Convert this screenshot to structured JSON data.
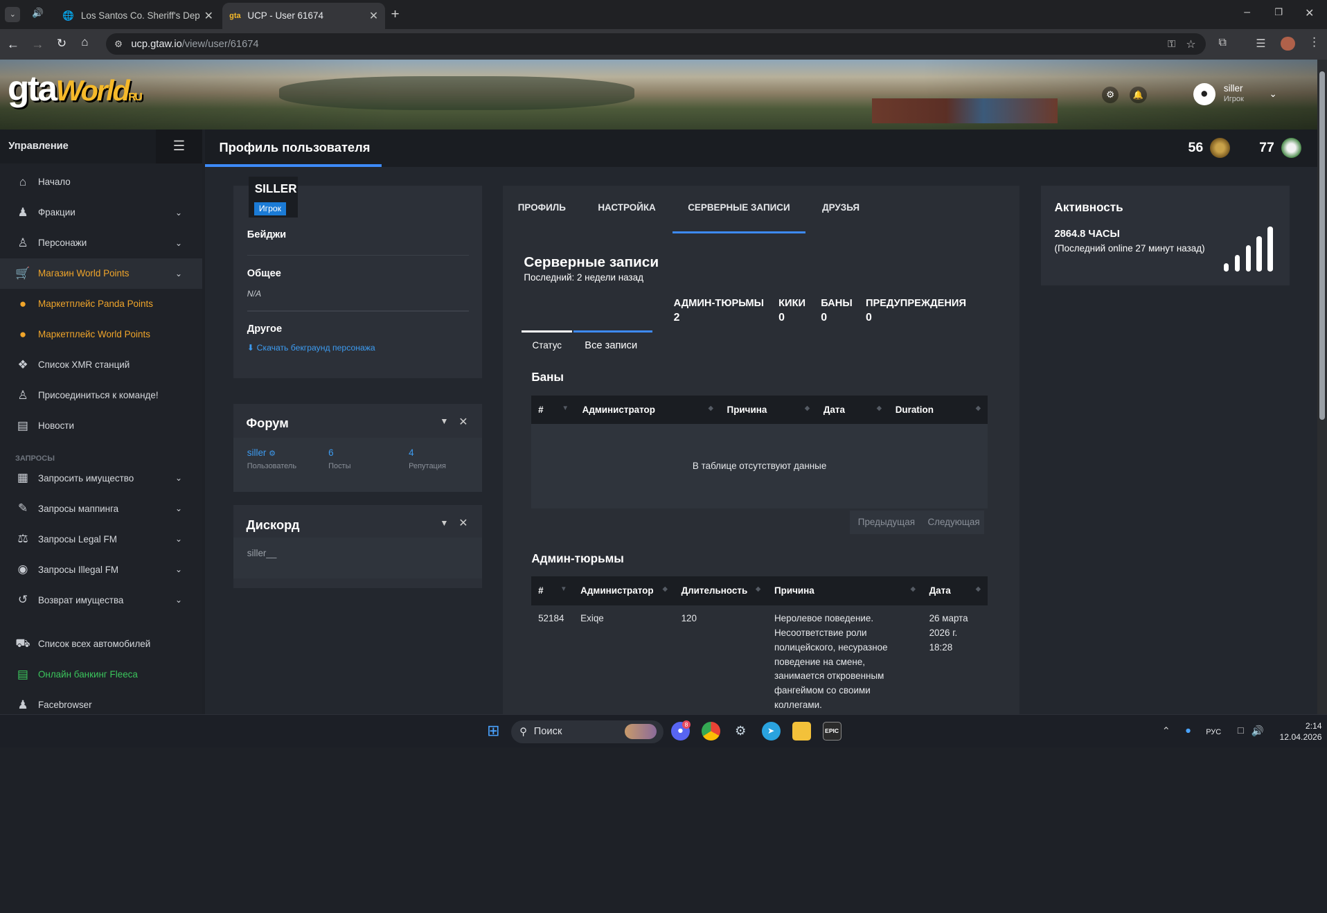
{
  "browser": {
    "tabs": [
      {
        "title": "Los Santos Co. Sheriff's Depart"
      },
      {
        "title": "UCP - User 61674"
      }
    ],
    "url_host": "ucp.gtaw.io",
    "url_path": "/view/user/61674"
  },
  "brand": {
    "logo_text": "gta",
    "logo_script": "World",
    "logo_suffix": "RU"
  },
  "topbar": {
    "user_name": "siller",
    "user_role": "Игрок"
  },
  "sidebar": {
    "header": "Управление",
    "items": [
      {
        "label": "Начало",
        "icon": "home-icon"
      },
      {
        "label": "Фракции",
        "icon": "users-icon"
      },
      {
        "label": "Персонажи",
        "icon": "user-icon"
      },
      {
        "label": "Магазин World Points",
        "icon": "cart-icon"
      },
      {
        "label": "Маркетплейс Panda Points",
        "icon": "coins-icon"
      },
      {
        "label": "Маркетплейс World Points",
        "icon": "coins-icon"
      },
      {
        "label": "Список XMR станций",
        "icon": "broadcast-icon"
      },
      {
        "label": "Присоединиться к команде!",
        "icon": "user-plus-icon"
      },
      {
        "label": "Новости",
        "icon": "newspaper-icon"
      }
    ],
    "section_requests": "ЗАПРОСЫ",
    "requests": [
      {
        "label": "Запросить имущество",
        "icon": "building-icon"
      },
      {
        "label": "Запросы маппинга",
        "icon": "paint-icon"
      },
      {
        "label": "Запросы Legal FM",
        "icon": "scale-icon"
      },
      {
        "label": "Запросы Illegal FM",
        "icon": "mask-icon"
      },
      {
        "label": "Возврат имущества",
        "icon": "undo-icon"
      }
    ],
    "bottom": [
      {
        "label": "Список всех автомобилей",
        "icon": "car-icon"
      },
      {
        "label": "Онлайн банкинг Fleeca",
        "icon": "bank-icon"
      },
      {
        "label": "Facebrowser",
        "icon": "users-icon"
      }
    ]
  },
  "header": {
    "title": "Профиль пользователя",
    "stat1": "56",
    "stat2": "77"
  },
  "profile": {
    "name": "SILLER",
    "role_badge": "Игрок",
    "badges_label": "Бейджи",
    "general_label": "Общее",
    "general_value": "N/A",
    "other_label": "Другое",
    "download_link": "Скачать бекграунд персонажа"
  },
  "forum": {
    "title": "Форум",
    "user": "siller",
    "user_label": "Пользователь",
    "posts": "6",
    "posts_label": "Посты",
    "rep": "4",
    "rep_label": "Репутация"
  },
  "discord": {
    "title": "Дискорд",
    "value": "siller__"
  },
  "tabs": {
    "profile": "ПРОФИЛЬ",
    "settings": "НАСТРОЙКА",
    "records": "СЕРВЕРНЫЕ ЗАПИСИ",
    "friends": "ДРУЗЬЯ"
  },
  "records": {
    "title": "Серверные записи",
    "last": "Последний: 2 недели назад",
    "counters": [
      {
        "label": "АДМИН-ТЮРЬМЫ",
        "value": "2"
      },
      {
        "label": "КИКИ",
        "value": "0"
      },
      {
        "label": "БАНЫ",
        "value": "0"
      },
      {
        "label": "ПРЕДУПРЕЖДЕНИЯ",
        "value": "0"
      }
    ],
    "subtab_status": "Статус",
    "subtab_all": "Все записи",
    "bans_title": "Баны",
    "bans_headers": [
      "#",
      "Администратор",
      "Причина",
      "Дата",
      "Duration"
    ],
    "bans_empty": "В таблице отсутствуют данные",
    "prev": "Предыдущая",
    "next": "Следующая",
    "jails_title": "Админ-тюрьмы",
    "jails_headers": [
      "#",
      "Администратор",
      "Длительность",
      "Причина",
      "Дата"
    ],
    "jails_rows": [
      {
        "id": "52184",
        "admin": "Exiqe",
        "duration": "120",
        "reason": "Неролевое поведение. Несоответствие роли полицейского, несуразное поведение на смене, занимается откровенным фангеймом со своими коллегами.",
        "date": "26 марта 2026 г. 18:28"
      }
    ]
  },
  "activity": {
    "title": "Активность",
    "hours": "2864.8 ЧАСЫ",
    "last_online": "(Последний online 27 минут назад)"
  },
  "taskbar": {
    "search_placeholder": "Поиск",
    "lang": "РУС",
    "time": "2:14",
    "date": "12.04.2026",
    "discord_badge": "8"
  }
}
